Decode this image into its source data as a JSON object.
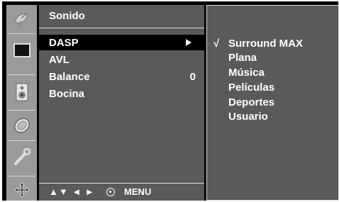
{
  "sidebar": {
    "icons": [
      "satellite-dish-icon",
      "screen-icon",
      "speaker-icon",
      "clock-icon",
      "tools-icon",
      "settings-icon"
    ]
  },
  "menu": {
    "title": "Sonido",
    "items": [
      {
        "label": "DASP",
        "value": "",
        "selected": true
      },
      {
        "label": "AVL",
        "value": ""
      },
      {
        "label": "Balance",
        "value": "0"
      },
      {
        "label": "Bocina",
        "value": ""
      }
    ],
    "footer": {
      "nav": "▲▼ ◄ ►",
      "menu": "MENU"
    }
  },
  "submenu": {
    "check": "√",
    "options": [
      "Surround MAX",
      "Plana",
      "Música",
      "Películas",
      "Deportes",
      "Usuario"
    ],
    "checked_index": 0
  }
}
